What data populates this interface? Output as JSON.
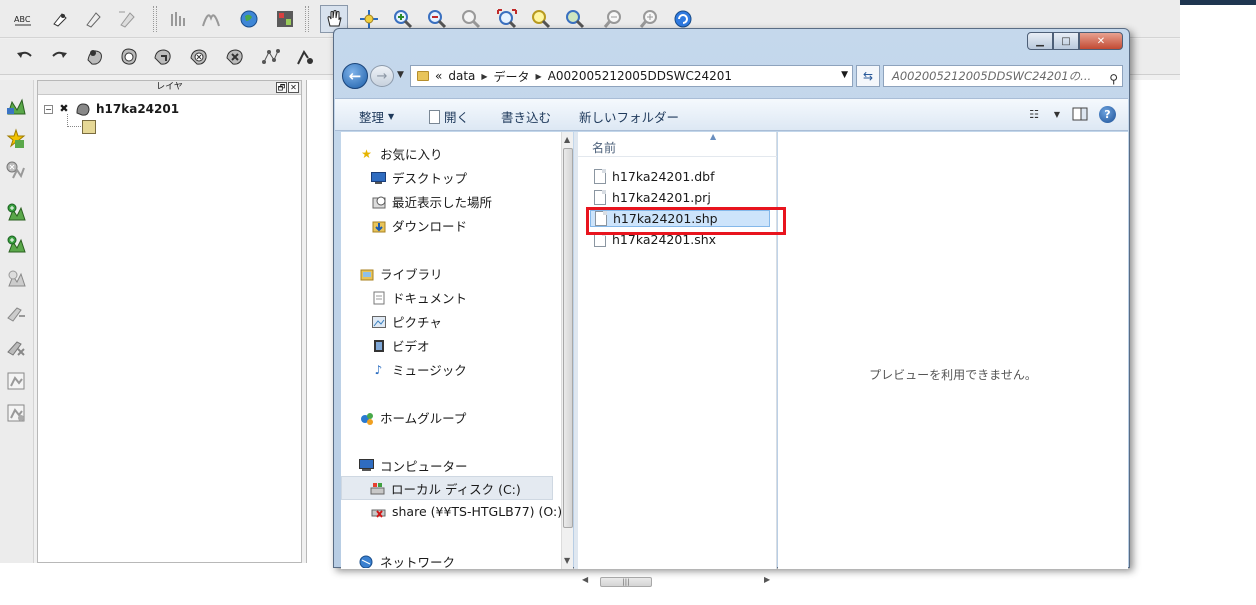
{
  "qgis": {
    "layer_panel_title": "レイヤ",
    "layer_name": "h17ka24201",
    "toolbar_more": "»",
    "layer_panel_float": "🗗",
    "layer_panel_close": "✕",
    "tree_expander": "−",
    "layer_check": "✖"
  },
  "dialog": {
    "window_controls": {
      "minimize": "▁",
      "maximize": "□",
      "close": "✕"
    },
    "breadcrumbs": [
      "data",
      "データ",
      "A002005212005DDSWC24201"
    ],
    "breadcrumb_overflow": "«",
    "search_placeholder": "A002005212005DDSWC24201の...",
    "commands": {
      "organize": "整理",
      "open": "開く",
      "write": "書き込む",
      "new_folder": "新しいフォルダー"
    },
    "nav": {
      "favorites": "お気に入り",
      "desktop": "デスクトップ",
      "recent": "最近表示した場所",
      "downloads": "ダウンロード",
      "library": "ライブラリ",
      "documents": "ドキュメント",
      "pictures": "ピクチャ",
      "videos": "ビデオ",
      "music": "ミュージック",
      "homegroup": "ホームグループ",
      "computer": "コンピューター",
      "local_disk": "ローカル ディスク (C:)",
      "share": "share (¥¥TS-HTGLB77) (O:)",
      "network": "ネットワーク"
    },
    "files_header": "名前",
    "files": [
      "h17ka24201.dbf",
      "h17ka24201.prj",
      "h17ka24201.shp",
      "h17ka24201.shx"
    ],
    "selected_file": "h17ka24201.shp",
    "preview_message": "プレビューを利用できません。"
  },
  "colors": {
    "highlight_box": "#e8141e",
    "selection": "#cde4fb",
    "command_text": "#1e395b"
  }
}
